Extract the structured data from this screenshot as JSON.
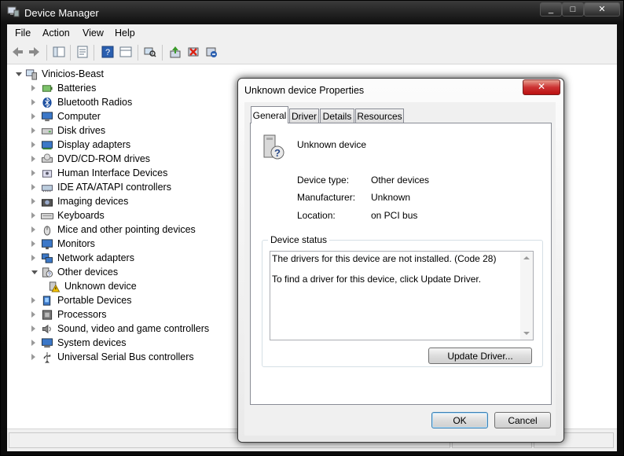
{
  "window": {
    "title": "Device Manager"
  },
  "caption_buttons": {
    "minimize": "_",
    "maximize": "□",
    "close": "✕"
  },
  "menu": [
    "File",
    "Action",
    "View",
    "Help"
  ],
  "toolbar_icons": [
    "back-arrow-icon",
    "forward-arrow-icon",
    "show-hide-tree-icon",
    "properties-icon",
    "help-icon",
    "view-icon",
    "scan-hardware-icon",
    "update-driver-icon",
    "disable-device-icon",
    "uninstall-device-icon"
  ],
  "tree": {
    "root": "Vinicios-Beast",
    "items": [
      {
        "label": "Batteries",
        "icon": "battery-icon"
      },
      {
        "label": "Bluetooth Radios",
        "icon": "bluetooth-icon"
      },
      {
        "label": "Computer",
        "icon": "computer-icon"
      },
      {
        "label": "Disk drives",
        "icon": "disk-drive-icon"
      },
      {
        "label": "Display adapters",
        "icon": "display-adapter-icon"
      },
      {
        "label": "DVD/CD-ROM drives",
        "icon": "dvd-drive-icon"
      },
      {
        "label": "Human Interface Devices",
        "icon": "hid-icon"
      },
      {
        "label": "IDE ATA/ATAPI controllers",
        "icon": "ide-controller-icon"
      },
      {
        "label": "Imaging devices",
        "icon": "camera-icon"
      },
      {
        "label": "Keyboards",
        "icon": "keyboard-icon"
      },
      {
        "label": "Mice and other pointing devices",
        "icon": "mouse-icon"
      },
      {
        "label": "Monitors",
        "icon": "monitor-icon"
      },
      {
        "label": "Network adapters",
        "icon": "network-adapter-icon"
      },
      {
        "label": "Other devices",
        "icon": "unknown-device-icon",
        "expanded": true
      },
      {
        "label": "Unknown device",
        "icon": "warning-device-icon",
        "child": true
      },
      {
        "label": "Portable Devices",
        "icon": "portable-device-icon"
      },
      {
        "label": "Processors",
        "icon": "processor-icon"
      },
      {
        "label": "Sound, video and game controllers",
        "icon": "sound-icon"
      },
      {
        "label": "System devices",
        "icon": "system-device-icon"
      },
      {
        "label": "Universal Serial Bus controllers",
        "icon": "usb-icon"
      }
    ]
  },
  "dialog": {
    "title": "Unknown device Properties",
    "close": "✕",
    "tabs": [
      "General",
      "Driver",
      "Details",
      "Resources"
    ],
    "active_tab": "General",
    "device_name": "Unknown device",
    "properties": [
      {
        "label": "Device type:",
        "value": "Other devices"
      },
      {
        "label": "Manufacturer:",
        "value": "Unknown"
      },
      {
        "label": "Location:",
        "value": "on PCI bus"
      }
    ],
    "status_group": "Device status",
    "status_line1": "The drivers for this device are not installed. (Code 28)",
    "status_line2": "To find a driver for this device, click Update Driver.",
    "update_button": "Update Driver...",
    "ok_button": "OK",
    "cancel_button": "Cancel"
  },
  "colors": {
    "aero_frame": "#111111",
    "dialog_close": "#c83a2a",
    "ok_border": "#3c7fb1"
  }
}
